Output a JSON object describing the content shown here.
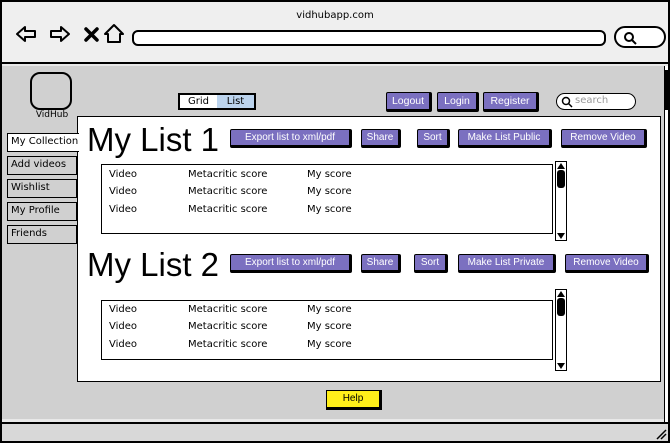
{
  "browser": {
    "url": "vidhubapp.com",
    "icons": [
      "back-arrow-icon",
      "forward-arrow-icon",
      "close-icon",
      "home-icon",
      "search-icon"
    ]
  },
  "app": {
    "logo_label": "VidHub"
  },
  "view_toggle": {
    "grid_label": "Grid",
    "list_label": "List",
    "active": "List"
  },
  "header": {
    "logout_label": "Logout",
    "login_label": "Login",
    "register_label": "Register",
    "search_placeholder": "search"
  },
  "sidebar": {
    "items": [
      {
        "label": "My Collection",
        "active": true
      },
      {
        "label": "Add videos"
      },
      {
        "label": "Wishlist"
      },
      {
        "label": "My Profile"
      },
      {
        "label": "Friends"
      }
    ]
  },
  "lists": [
    {
      "title": "My List 1",
      "actions": [
        "Export list to xml/pdf",
        "Share",
        "Sort",
        "Make List Public",
        "Remove Video"
      ],
      "rows": [
        {
          "video": "Video",
          "metacritic": "Metacritic score",
          "my_score": "My score"
        },
        {
          "video": "Video",
          "metacritic": "Metacritic score",
          "my_score": "My score"
        },
        {
          "video": "Video",
          "metacritic": "Metacritic score",
          "my_score": "My score"
        }
      ]
    },
    {
      "title": "My List 2",
      "actions": [
        "Export list to xml/pdf",
        "Share",
        "Sort",
        "Make List Private",
        "Remove Video"
      ],
      "rows": [
        {
          "video": "Video",
          "metacritic": "Metacritic score",
          "my_score": "My score"
        },
        {
          "video": "Video",
          "metacritic": "Metacritic score",
          "my_score": "My score"
        },
        {
          "video": "Video",
          "metacritic": "Metacritic score",
          "my_score": "My score"
        }
      ]
    }
  ],
  "footer": {
    "help_label": "Help"
  },
  "colors": {
    "button": "#7b70c0",
    "help": "#ffef1a",
    "toggle_active": "#bcd4ee",
    "page_bg": "#d0d0d0"
  }
}
